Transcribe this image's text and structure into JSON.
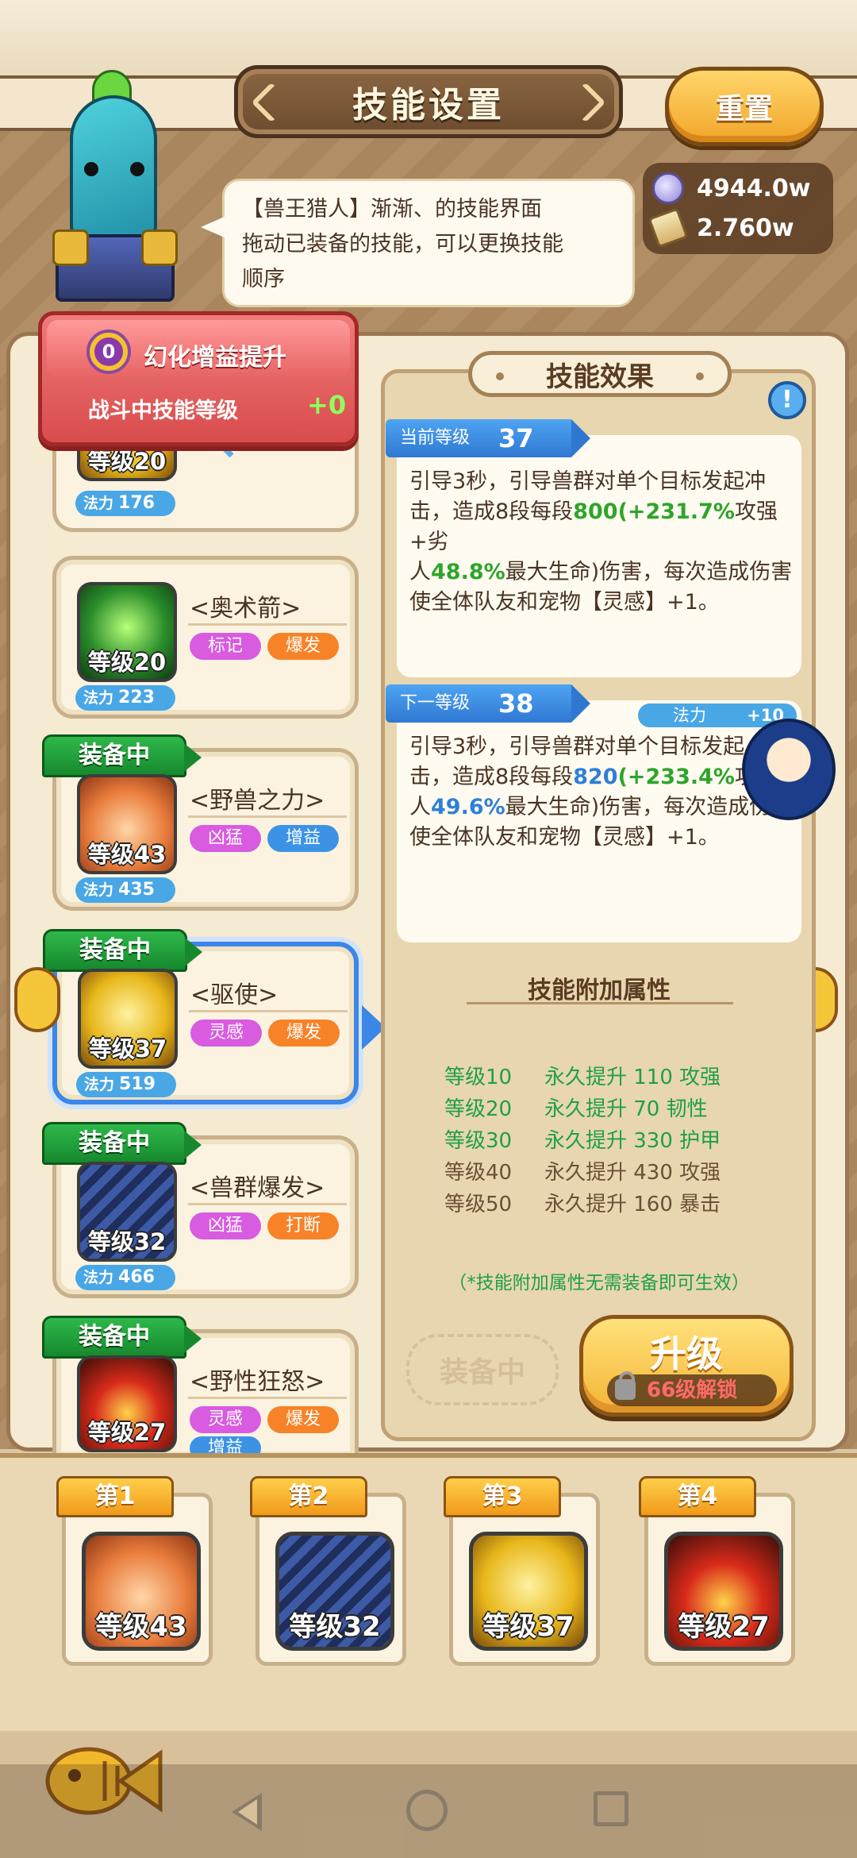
{
  "header": {
    "title": "技能设置",
    "reset_label": "重置"
  },
  "currency": [
    {
      "icon": "gem-icon",
      "value": "4944.0w"
    },
    {
      "icon": "scroll-icon",
      "value": "2.760w"
    }
  ],
  "dialog": {
    "line1": "【兽王猎人】渐渐、的技能界面",
    "line2": "拖动已装备的技能，可以更换技能",
    "line3": "顺序"
  },
  "buff": {
    "badge": "0",
    "title": "幻化增益提升",
    "subtitle": "战斗中技能等级",
    "value": "+0"
  },
  "partial_skill": {
    "level": "等级20",
    "mana_label": "法力",
    "mana": "176"
  },
  "skills": [
    {
      "name": "<奥术箭>",
      "level": "等级20",
      "mana_label": "法力",
      "mana": "223",
      "tags": [
        "标记",
        "爆发"
      ],
      "equipped": false,
      "equip_label": ""
    },
    {
      "name": "<野兽之力>",
      "level": "等级43",
      "mana_label": "法力",
      "mana": "435",
      "tags": [
        "凶猛",
        "增益"
      ],
      "equipped": true,
      "equip_label": "装备中"
    },
    {
      "name": "<驱使>",
      "level": "等级37",
      "mana_label": "法力",
      "mana": "519",
      "tags": [
        "灵感",
        "爆发"
      ],
      "equipped": true,
      "equip_label": "装备中"
    },
    {
      "name": "<兽群爆发>",
      "level": "等级32",
      "mana_label": "法力",
      "mana": "466",
      "tags": [
        "凶猛",
        "打断"
      ],
      "equipped": true,
      "equip_label": "装备中"
    },
    {
      "name": "<野性狂怒>",
      "level": "等级27",
      "mana_label": "",
      "mana": "",
      "tags": [
        "灵感",
        "爆发",
        "增益"
      ],
      "equipped": true,
      "equip_label": "装备中"
    }
  ],
  "detail": {
    "header": "技能效果",
    "info_label": "!",
    "current": {
      "label": "当前等级",
      "level": "37",
      "t1": "引导3秒，引导兽群对单个目标发起冲",
      "t2a": "击，造成8段每段",
      "t2b": "800",
      "t2c": "(+231.7%",
      "t2d": "攻强+劣",
      "t3a": "人",
      "t3b": "48.8%",
      "t3c": "最大生命)伤害，每次造成伤害",
      "t4": "使全体队友和宠物【灵感】+1。"
    },
    "next": {
      "label": "下一等级",
      "level": "38",
      "mana_label": "法力",
      "mana_bonus": "+10",
      "t1": "引导3秒，引导兽群对单个目标发起",
      "t2a": "击，造成8段每段",
      "t2b": "820",
      "t2c": "(+233.4%",
      "t2d": "攻强",
      "t3a": "人",
      "t3b": "49.6%",
      "t3c": "最大生命)伤害，每次造成伤",
      "t4": "使全体队友和宠物【灵感】+1。"
    },
    "bonus_title": "技能附加属性",
    "bonus_rows": [
      {
        "level": "等级10",
        "effect": "永久提升 110 攻强",
        "unlocked": true
      },
      {
        "level": "等级20",
        "effect": "永久提升 70 韧性",
        "unlocked": true
      },
      {
        "level": "等级30",
        "effect": "永久提升 330 护甲",
        "unlocked": true
      },
      {
        "level": "等级40",
        "effect": "永久提升 430 攻强",
        "unlocked": false
      },
      {
        "level": "等级50",
        "effect": "永久提升 160 暴击",
        "unlocked": false
      }
    ],
    "bonus_note": "（*技能附加属性无需装备即可生效）",
    "equip_button": "装备中",
    "upgrade_button": "升级",
    "unlock_text": "66级解锁"
  },
  "slots": [
    {
      "label": "第1",
      "level": "等级43"
    },
    {
      "label": "第2",
      "level": "等级32"
    },
    {
      "label": "第3",
      "level": "等级37"
    },
    {
      "label": "第4",
      "level": "等级27"
    }
  ],
  "colors": {
    "equip_green": "#16892d",
    "tag_purple": "#d85be0",
    "tag_orange": "#f78228",
    "tag_blue": "#3c93e6",
    "highlight_green": "#2ea52a",
    "highlight_blue": "#2f7fd8",
    "selected_border": "#3c86e8"
  }
}
